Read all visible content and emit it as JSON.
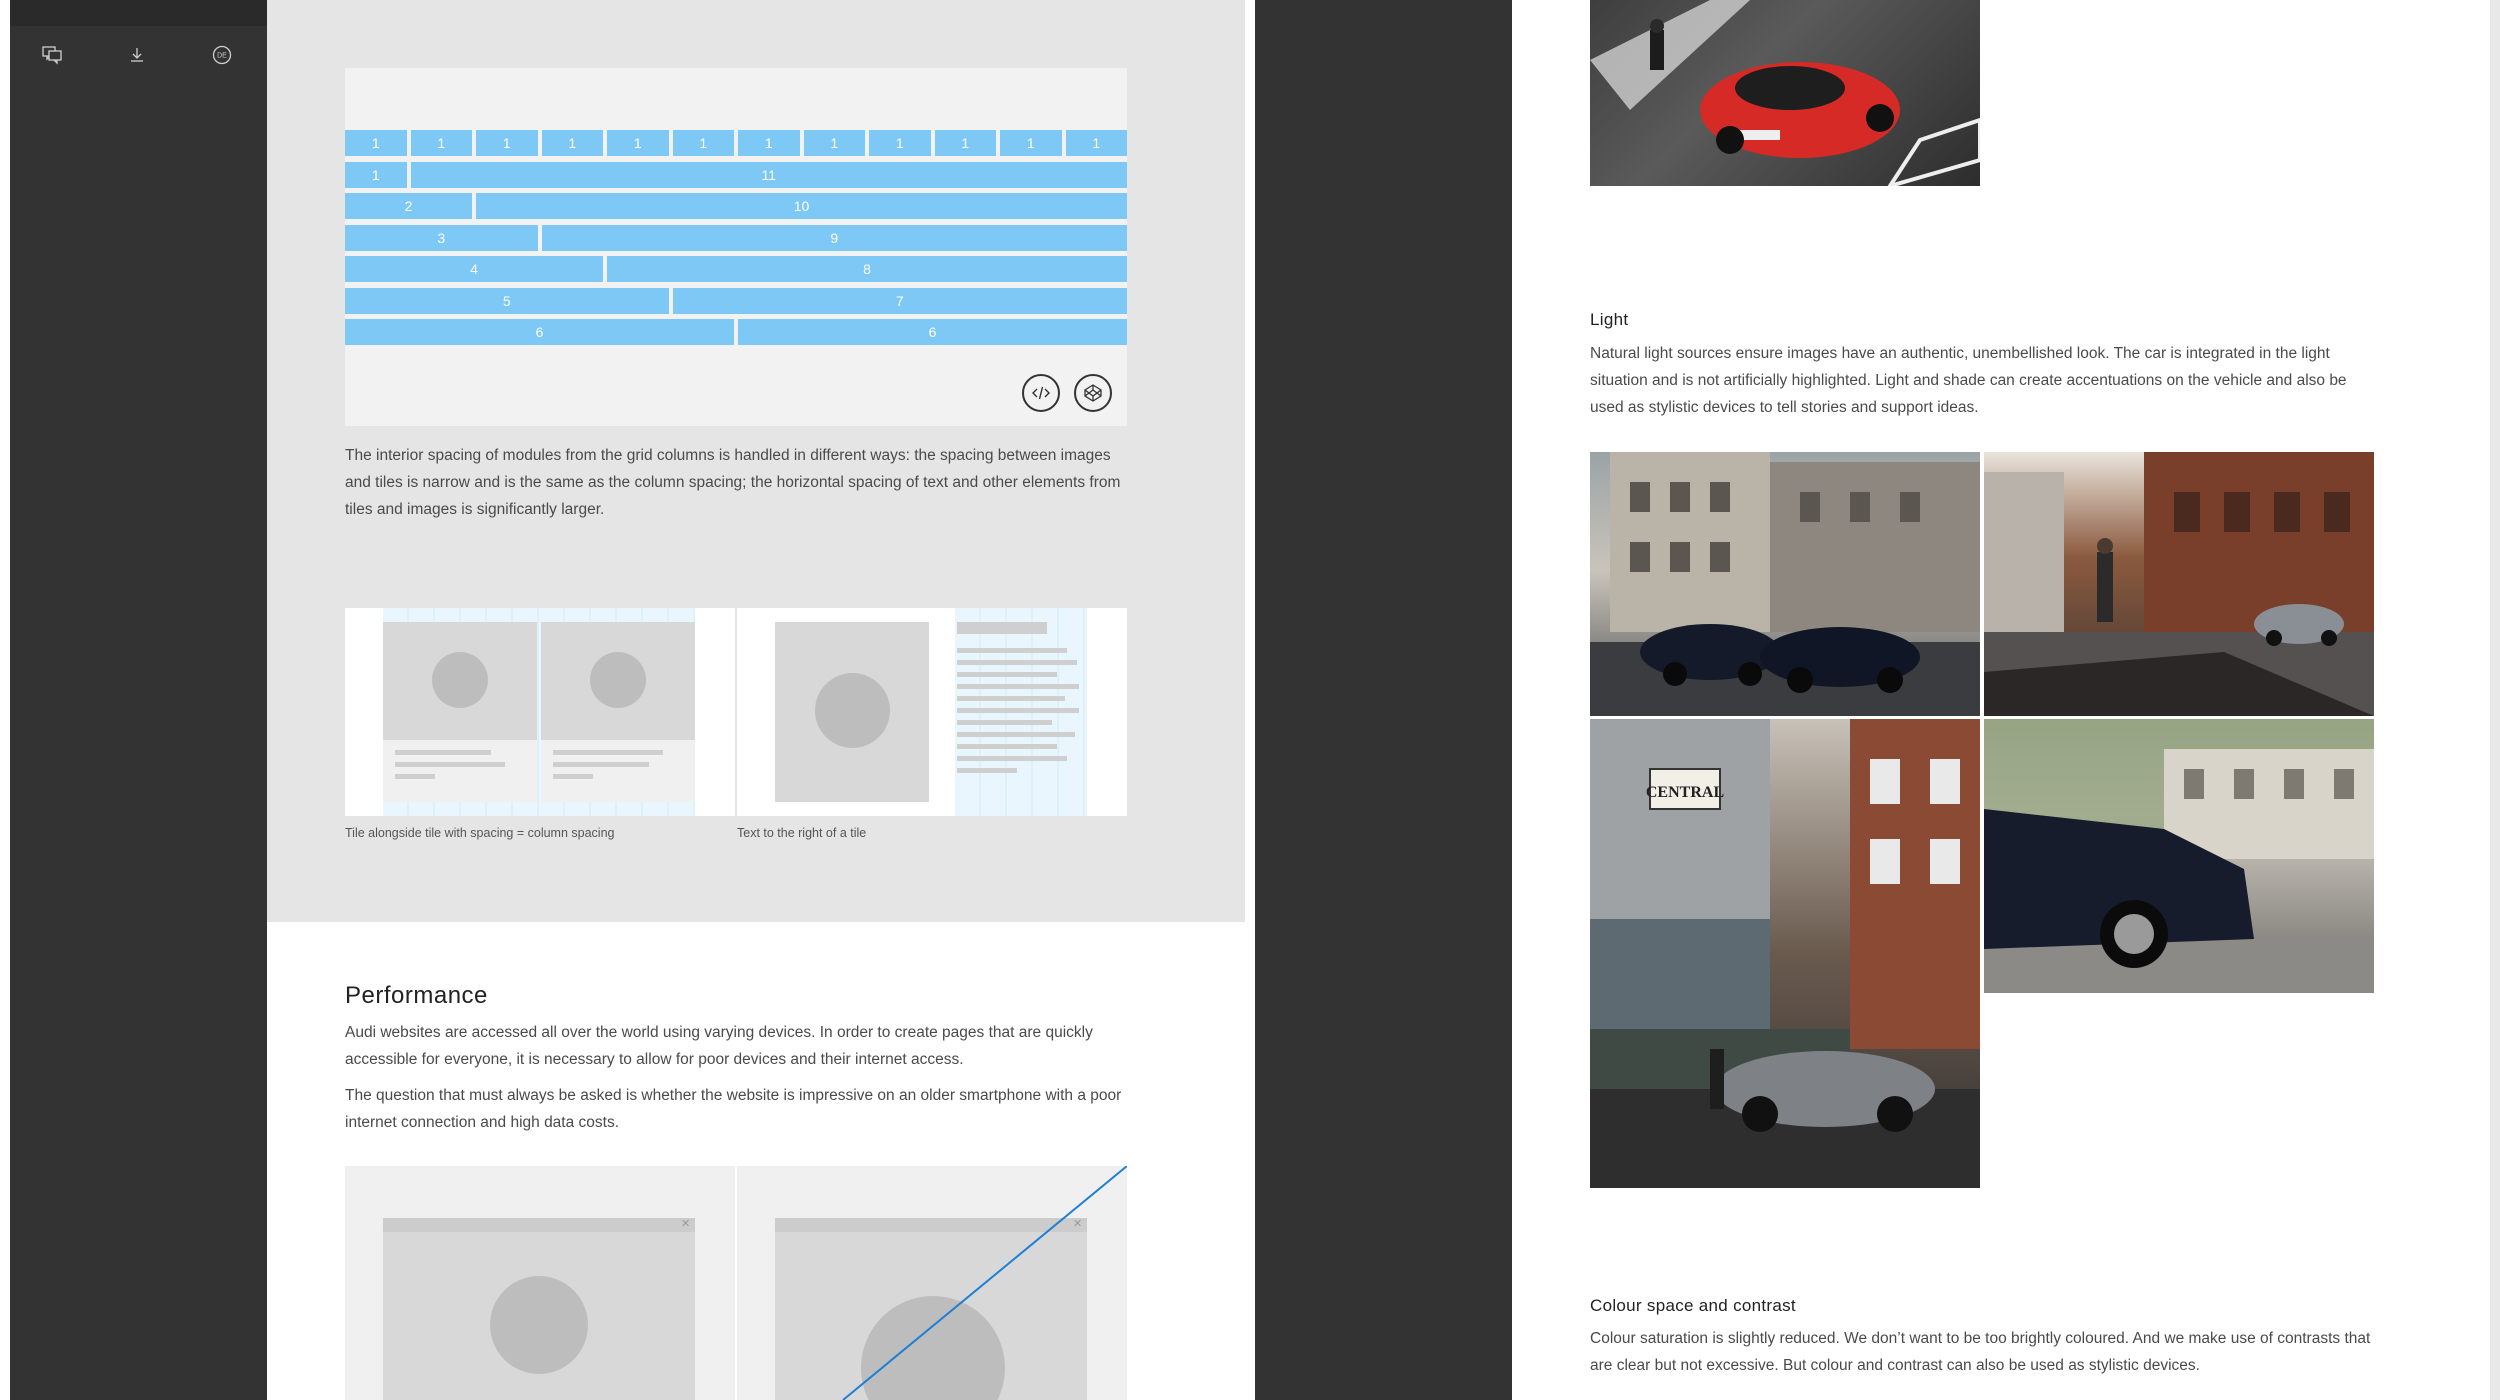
{
  "sidebar": {
    "icons": [
      {
        "name": "comments-icon"
      },
      {
        "name": "download-icon"
      },
      {
        "name": "language-de-icon",
        "label": "DE"
      }
    ]
  },
  "grid_demo": {
    "rows": [
      [
        "1",
        "1",
        "1",
        "1",
        "1",
        "1",
        "1",
        "1",
        "1",
        "1",
        "1",
        "1"
      ],
      [
        "1",
        "11"
      ],
      [
        "2",
        "10"
      ],
      [
        "3",
        "9"
      ],
      [
        "4",
        "8"
      ],
      [
        "5",
        "7"
      ],
      [
        "6",
        "6"
      ]
    ],
    "buttons": [
      {
        "name": "code-icon"
      },
      {
        "name": "codepen-icon"
      }
    ]
  },
  "spacing_paragraph": "The interior spacing of modules from the grid columns is handled in different ways: the spacing between images and tiles is narrow and is the same as the column spacing; the horizontal spacing of text and other elements from tiles and images is significantly larger.",
  "captions": {
    "tile_alongside": "Tile alongside tile with spacing = column spacing",
    "text_right": "Text to the right of a tile"
  },
  "performance": {
    "title": "Performance",
    "p1": "Audi websites are accessed all over the world using varying devices. In order to create pages that are quickly accessible for everyone, it is necessary to allow for poor devices and their internet access.",
    "p2": "The question that must always be asked is whether the website is impressive on an older smartphone with a poor internet connection and high data costs."
  },
  "light": {
    "title": "Light",
    "text": "Natural light sources ensure images have an authentic, unembellished look. The car is integrated in the light situation and is not artificially highlighted. Light and shade can create accentuations on the vehicle and also be used as stylistic devices to tell stories and support ideas."
  },
  "colour": {
    "title": "Colour space and contrast",
    "text": "Colour saturation is slightly reduced. We don’t want to be too brightly coloured. And we make use of contrasts that are clear but not excessive. But colour and contrast can also be used as stylistic devices."
  },
  "photo_sign": "CENTRAL",
  "colors": {
    "sidebar": "#333333",
    "grid_blue": "#7ec8f5",
    "panel_grey": "#e5e5e5"
  }
}
